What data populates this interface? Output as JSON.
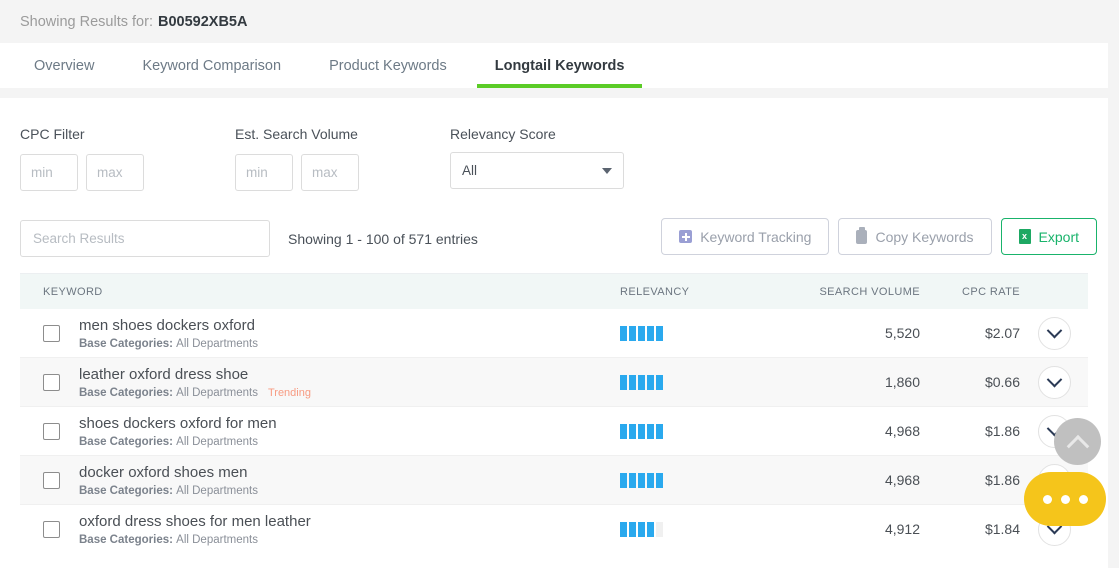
{
  "header": {
    "showing_label": "Showing Results for:",
    "asin": "B00592XB5A"
  },
  "tabs": [
    {
      "label": "Overview",
      "active": false
    },
    {
      "label": "Keyword Comparison",
      "active": false
    },
    {
      "label": "Product Keywords",
      "active": false
    },
    {
      "label": "Longtail Keywords",
      "active": true
    }
  ],
  "filters": {
    "cpc": {
      "label": "CPC Filter",
      "min_placeholder": "min",
      "max_placeholder": "max",
      "min_value": "",
      "max_value": ""
    },
    "volume": {
      "label": "Est. Search Volume",
      "min_placeholder": "min",
      "max_placeholder": "max",
      "min_value": "",
      "max_value": ""
    },
    "relevancy": {
      "label": "Relevancy Score",
      "selected": "All",
      "options": [
        "All"
      ]
    }
  },
  "toolbar": {
    "search_placeholder": "Search Results",
    "search_value": "",
    "entries_text": "Showing 1 - 100 of 571 entries",
    "keyword_tracking_label": "Keyword Tracking",
    "copy_keywords_label": "Copy Keywords",
    "export_label": "Export",
    "export_icon_glyph": "x"
  },
  "table": {
    "columns": [
      "KEYWORD",
      "RELEVANCY",
      "SEARCH VOLUME",
      "CPC RATE"
    ],
    "base_categories_label": "Base Categories:",
    "relevancy_max": 5,
    "rows": [
      {
        "keyword": "men shoes dockers oxford",
        "base_categories": "All Departments",
        "badge": "",
        "relevancy": 5,
        "search_volume": "5,520",
        "cpc_rate": "$2.07"
      },
      {
        "keyword": "leather oxford dress shoe",
        "base_categories": "All Departments",
        "badge": "Trending",
        "relevancy": 5,
        "search_volume": "1,860",
        "cpc_rate": "$0.66"
      },
      {
        "keyword": "shoes dockers oxford for men",
        "base_categories": "All Departments",
        "badge": "",
        "relevancy": 5,
        "search_volume": "4,968",
        "cpc_rate": "$1.86"
      },
      {
        "keyword": "docker oxford shoes men",
        "base_categories": "All Departments",
        "badge": "",
        "relevancy": 5,
        "search_volume": "4,968",
        "cpc_rate": "$1.86"
      },
      {
        "keyword": "oxford dress shoes for men leather",
        "base_categories": "All Departments",
        "badge": "",
        "relevancy": 4,
        "search_volume": "4,912",
        "cpc_rate": "$1.84"
      }
    ]
  },
  "floating": {
    "scroll_top_icon": "chevron-up-icon",
    "chat_icon": "ellipsis-icon"
  },
  "colors": {
    "accent_green": "#5bcc26",
    "export_green": "#19b36b",
    "relevancy_blue": "#2aa9ee",
    "trending_orange": "#f79b82",
    "chat_yellow": "#f5c51b",
    "scrolltop_grey": "#c0c0c0"
  }
}
